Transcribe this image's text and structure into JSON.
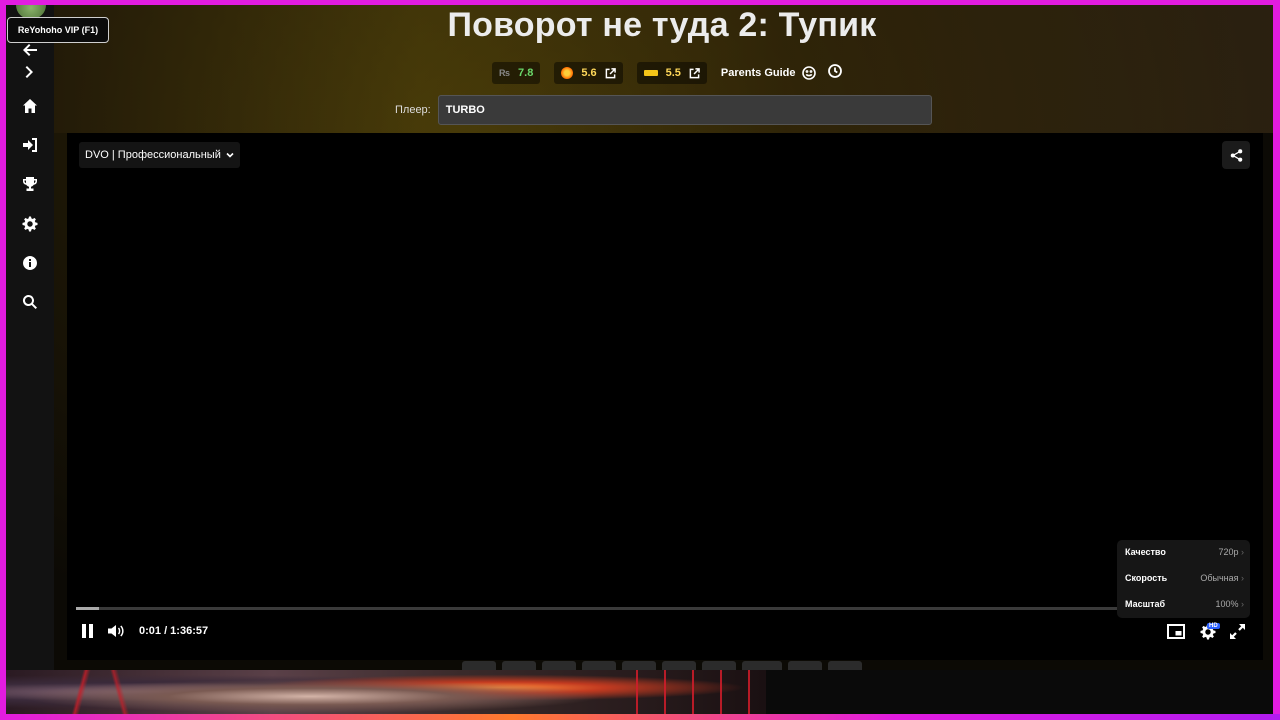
{
  "tooltip": {
    "label": "ReYohoho VIP (F1)"
  },
  "sidebar": {
    "items": [
      {
        "name": "back",
        "icon": "arrow-left-icon"
      },
      {
        "name": "forward",
        "icon": "chevron-right-icon"
      },
      {
        "name": "home",
        "icon": "home-icon"
      },
      {
        "name": "login",
        "icon": "sign-in-icon"
      },
      {
        "name": "top",
        "icon": "trophy-icon"
      },
      {
        "name": "settings",
        "icon": "gear-icon"
      },
      {
        "name": "info",
        "icon": "info-icon"
      },
      {
        "name": "search",
        "icon": "search-icon"
      }
    ]
  },
  "movie": {
    "title": "Поворот не туда 2: Тупик",
    "ratings": {
      "kp": "7.8",
      "tmdb": "5.6",
      "imdb": "5.5"
    },
    "parents_guide": "Parents Guide"
  },
  "player": {
    "label": "Плеер:",
    "selected": "TURBO"
  },
  "video": {
    "voice": "DVO | Профессиональный",
    "current_time": "0:01",
    "duration": "1:36:57",
    "time_display": "0:01 / 1:36:57",
    "progress_fraction": 0.0002,
    "buffered_fraction": 0.022,
    "settings_menu": [
      {
        "key": "Качество",
        "value": "720p"
      },
      {
        "key": "Скорость",
        "value": "Обычная"
      },
      {
        "key": "Масштаб",
        "value": "100%"
      }
    ],
    "hd_badge": "HD"
  },
  "colors": {
    "frame": "#e21ce0",
    "rating_green": "#6ad86a",
    "rating_yellow": "#ffd85a"
  }
}
